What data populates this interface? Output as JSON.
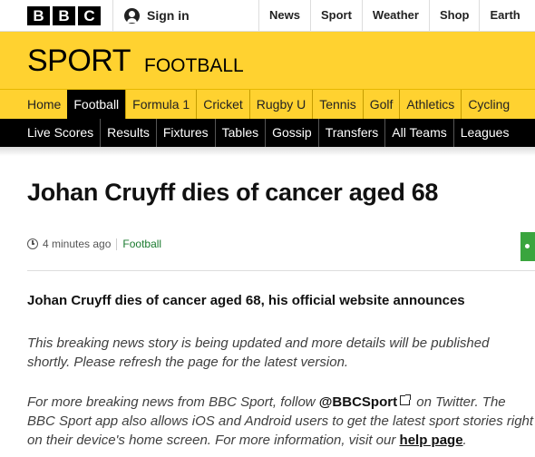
{
  "topbar": {
    "logo_letters": [
      "B",
      "B",
      "C"
    ],
    "signin_label": "Sign in",
    "nav": [
      "News",
      "Sport",
      "Weather",
      "Shop",
      "Earth"
    ]
  },
  "sport": {
    "title": "SPORT",
    "subtitle": "FOOTBALL"
  },
  "section_nav": {
    "items": [
      "Home",
      "Football",
      "Formula 1",
      "Cricket",
      "Rugby U",
      "Tennis",
      "Golf",
      "Athletics",
      "Cycling"
    ],
    "active": "Football"
  },
  "sub_nav": {
    "items": [
      "Live Scores",
      "Results",
      "Fixtures",
      "Tables",
      "Gossip",
      "Transfers",
      "All Teams",
      "Leagues"
    ]
  },
  "article": {
    "headline": "Johan Cruyff dies of cancer aged 68",
    "timestamp": "4 minutes ago",
    "tag": "Football",
    "lead": "Johan Cruyff dies of cancer aged 68, his official website announces",
    "para1": "This breaking news story is being updated and more details will be published shortly. Please refresh the page for the latest version.",
    "para2_a": "For more breaking news from BBC Sport, follow ",
    "twitter_handle": "@BBCSport",
    "para2_b": " on Twitter. The BBC Sport app also allows iOS and Android users to get the latest sport stories right on their device's home screen. For more information, visit our ",
    "help_link": "help page",
    "para2_c": "."
  },
  "colors": {
    "sport_yellow": "#ffd230",
    "tag_green": "#1a7a2e",
    "share_green": "#3aa53e"
  }
}
